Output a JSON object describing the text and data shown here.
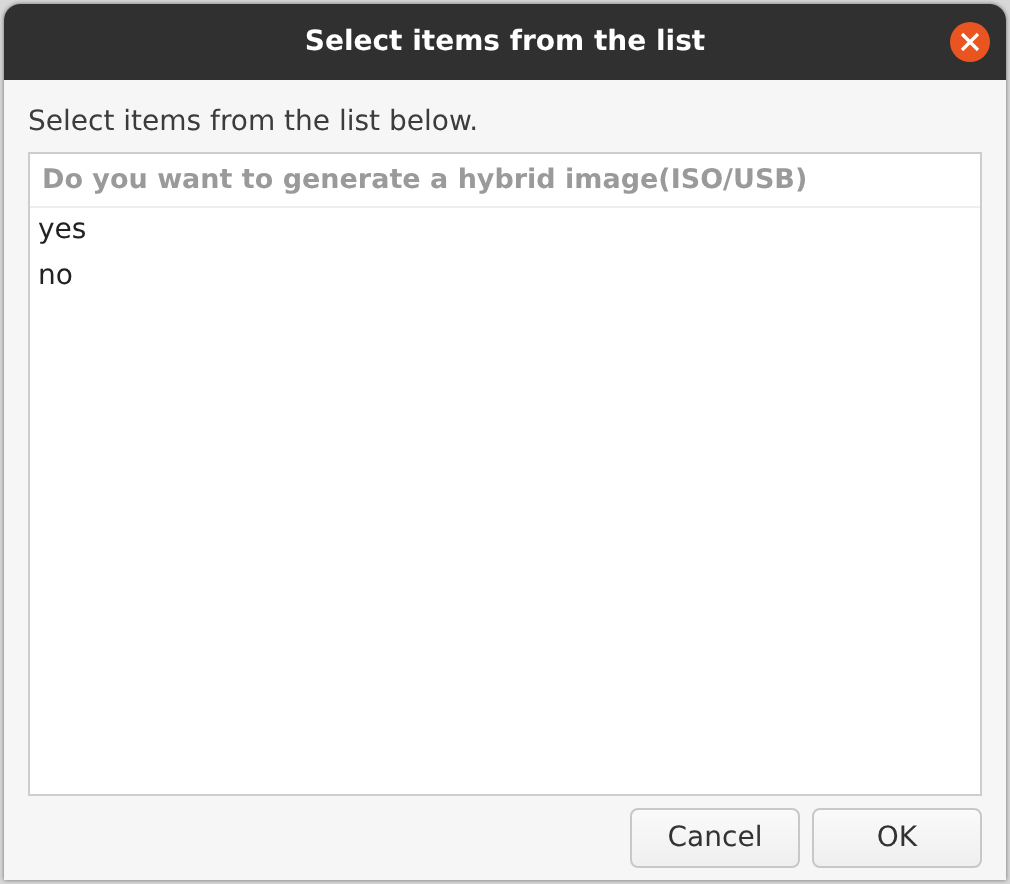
{
  "window": {
    "title": "Select items from the list"
  },
  "prompt": "Select items from the list below.",
  "list": {
    "column_header": "Do you want to generate a hybrid image(ISO/USB)",
    "rows": [
      {
        "label": "yes",
        "selected": false
      },
      {
        "label": "no",
        "selected": false
      }
    ]
  },
  "buttons": [
    "Cancel",
    "OK"
  ]
}
